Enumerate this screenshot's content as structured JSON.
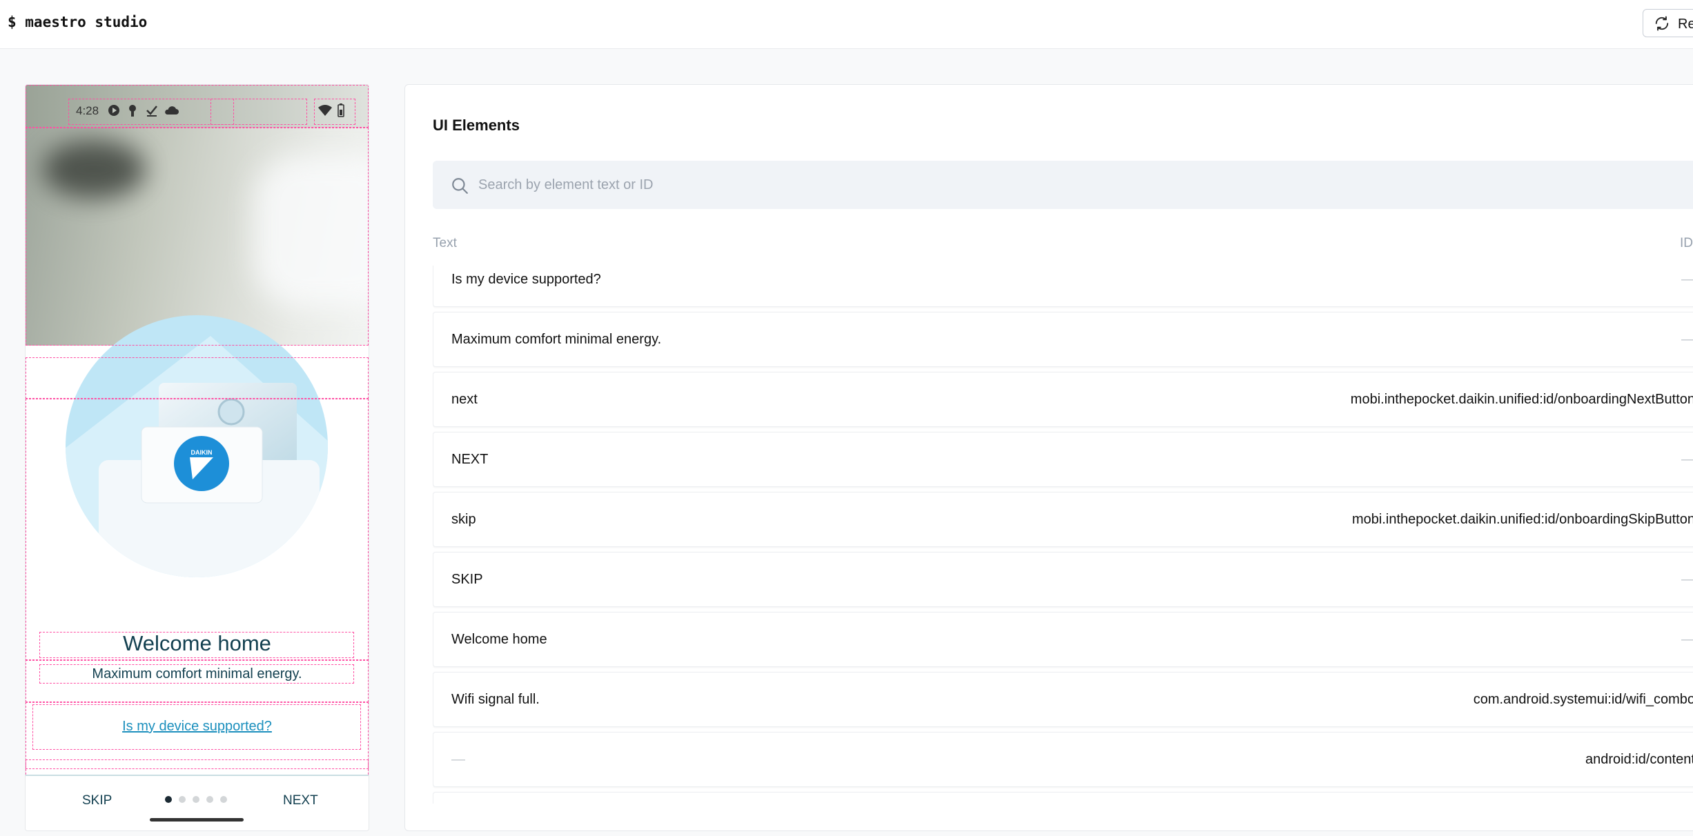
{
  "app": {
    "title": "$ maestro studio",
    "refresh_label": "Re"
  },
  "device": {
    "status_time": "4:28",
    "welcome": "Welcome home",
    "subtitle": "Maximum comfort minimal energy.",
    "supported_link": "Is my device supported?",
    "skip": "SKIP",
    "next": "NEXT",
    "page_indicator": {
      "count": 5,
      "active": 1
    },
    "illustration_brand": "DAIKIN"
  },
  "panel": {
    "title": "UI Elements",
    "search_placeholder": "Search by element text or ID",
    "col_text": "Text",
    "col_id": "ID",
    "rows": [
      {
        "text": "Is my device supported?",
        "id": "—"
      },
      {
        "text": "Maximum comfort minimal energy.",
        "id": "—"
      },
      {
        "text": "next",
        "id": "mobi.inthepocket.daikin.unified:id/onboardingNextButton"
      },
      {
        "text": "NEXT",
        "id": "—"
      },
      {
        "text": "skip",
        "id": "mobi.inthepocket.daikin.unified:id/onboardingSkipButton"
      },
      {
        "text": "SKIP",
        "id": "—"
      },
      {
        "text": "Welcome home",
        "id": "—"
      },
      {
        "text": "Wifi signal full.",
        "id": "com.android.systemui:id/wifi_combo"
      },
      {
        "text": "—",
        "id": "android:id/content"
      }
    ]
  },
  "colors": {
    "accent_link": "#1b8fbd",
    "text_teal": "#134050",
    "debug_outline": "#ff4fa3"
  }
}
